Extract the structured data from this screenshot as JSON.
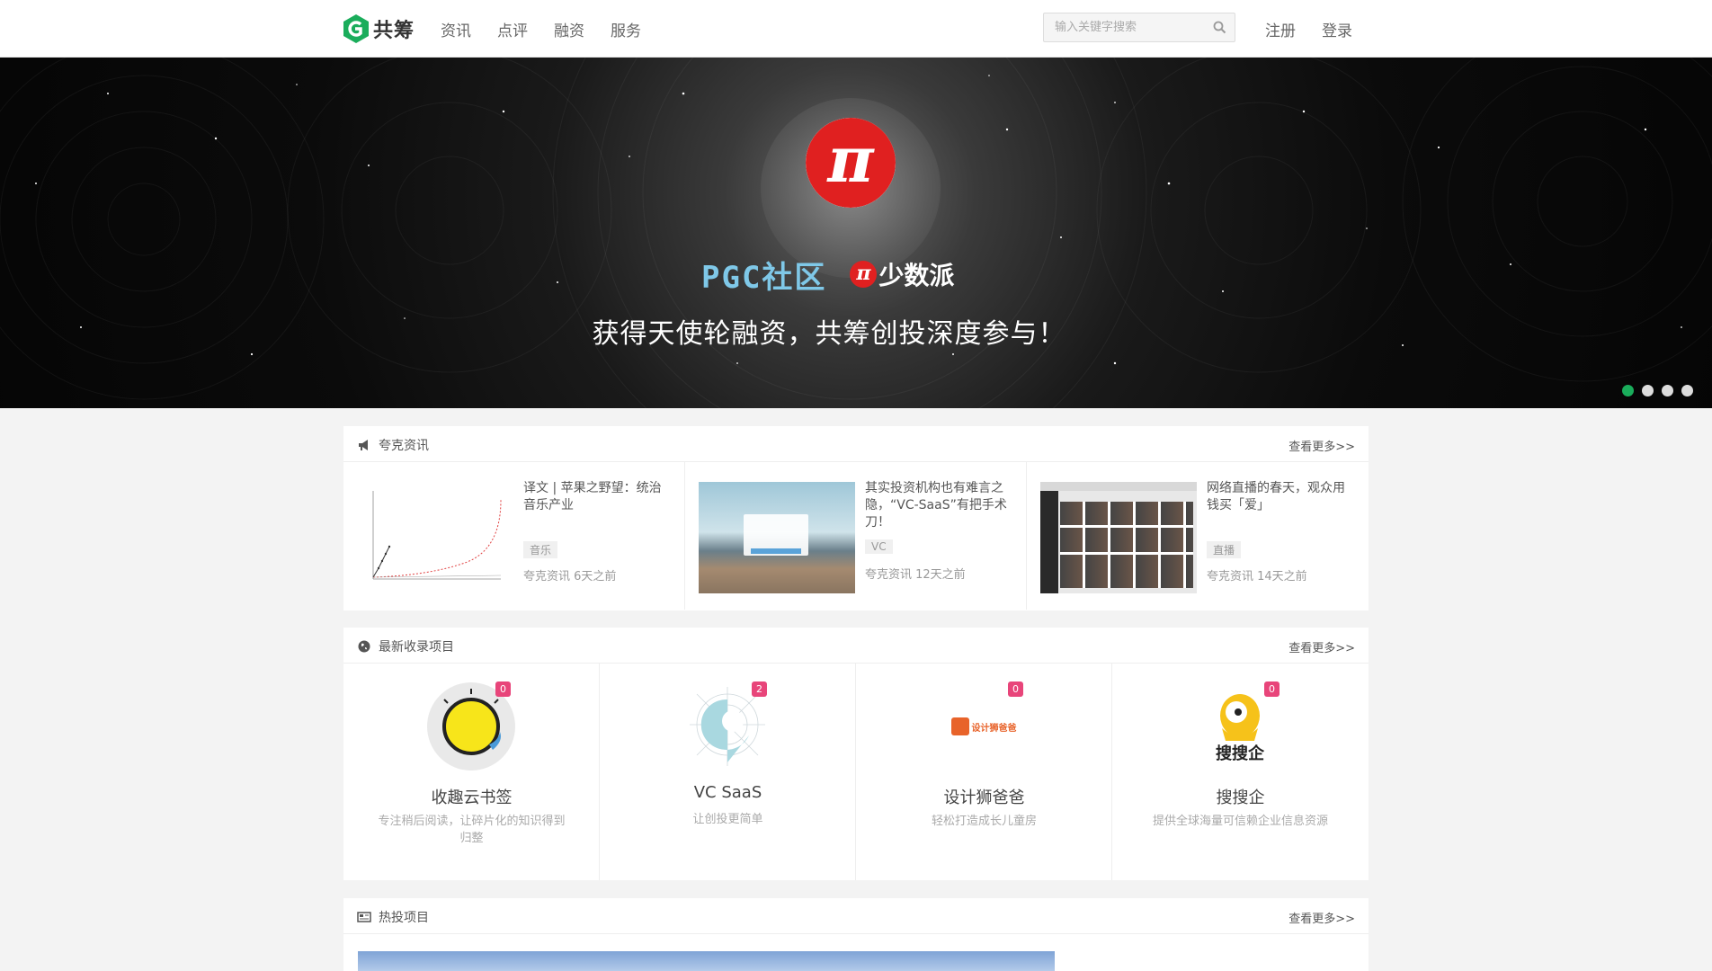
{
  "header": {
    "logo_text": "共筹",
    "nav": [
      "资讯",
      "点评",
      "融资",
      "服务"
    ],
    "search_placeholder": "输入关键字搜索",
    "register": "注册",
    "login": "登录"
  },
  "banner": {
    "pgc": "PGC社区",
    "brand": "少数派",
    "slogan": "获得天使轮融资，共筹创投深度参与！",
    "slides": 4,
    "active_slide": 0
  },
  "news": {
    "title": "夸克资讯",
    "more": "查看更多>>",
    "items": [
      {
        "title": "译文 | 苹果之野望：统治音乐产业",
        "tag": "音乐",
        "meta": "夸克资讯 6天之前"
      },
      {
        "title": "其实投资机构也有难言之隐，“VC-SaaS”有把手术刀！",
        "tag": "VC",
        "meta": "夸克资讯 12天之前"
      },
      {
        "title": "网络直播的春天，观众用钱买「爱」",
        "tag": "直播",
        "meta": "夸克资讯 14天之前"
      }
    ]
  },
  "projects": {
    "title": "最新收录项目",
    "more": "查看更多>>",
    "items": [
      {
        "name": "收趣云书签",
        "desc": "专注稍后阅读，让碎片化的知识得到归整",
        "count": "0"
      },
      {
        "name": "VC SaaS",
        "desc": "让创投更简单",
        "count": "2"
      },
      {
        "name": "设计狮爸爸",
        "desc": "轻松打造成长儿童房",
        "count": "0",
        "logo_text": "设计狮爸爸"
      },
      {
        "name": "搜搜企",
        "desc": "提供全球海量可信赖企业信息资源",
        "count": "0",
        "logo_text": "搜搜企"
      }
    ]
  },
  "hot": {
    "title": "热投项目",
    "more": "查看更多>>"
  },
  "colors": {
    "accent": "#1aad5b",
    "badge": "#e8457a",
    "brand_red": "#e02020"
  }
}
